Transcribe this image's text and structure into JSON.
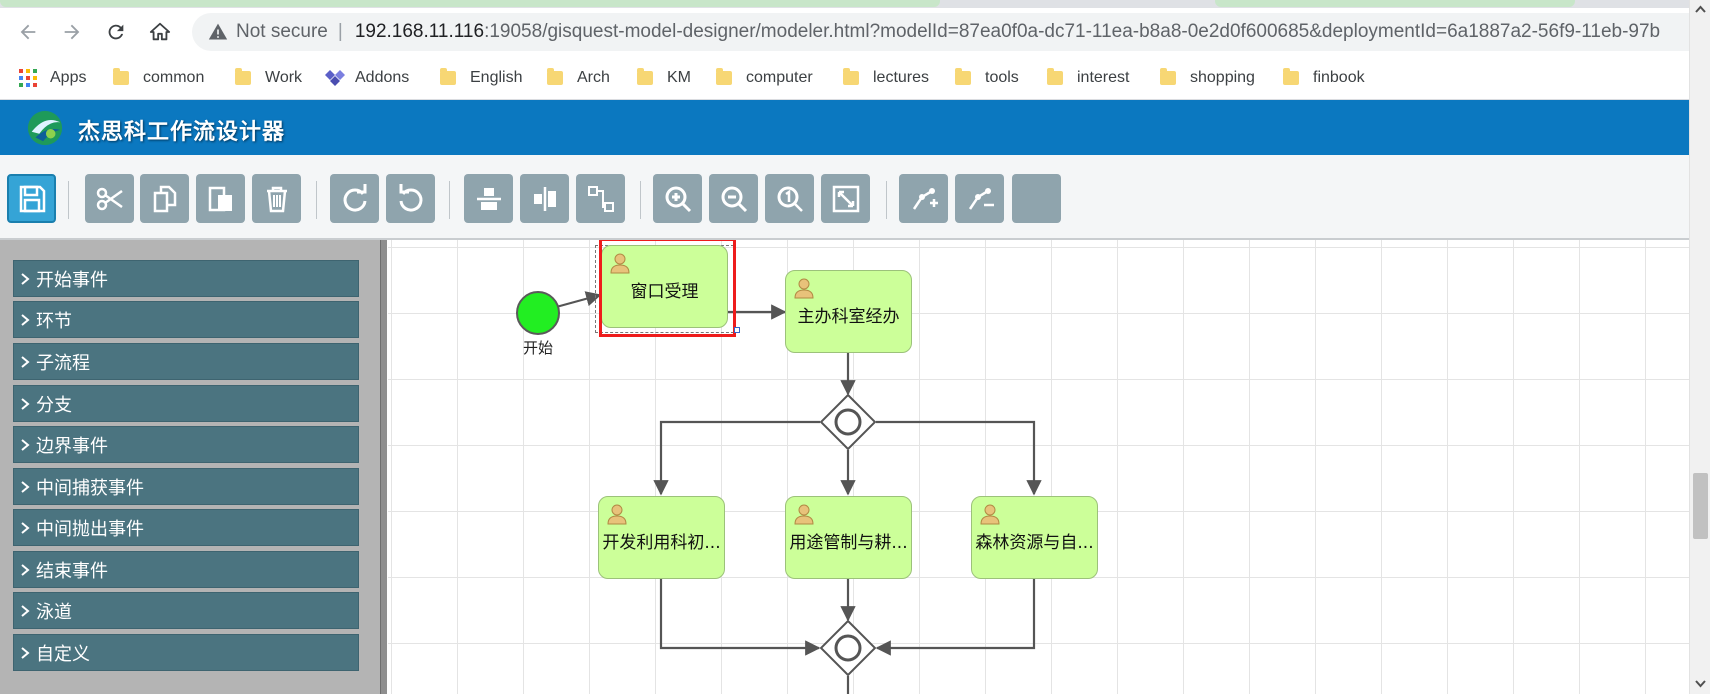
{
  "browser": {
    "url_not_secure": "Not secure",
    "url_host": "192.168.11.116",
    "url_rest": ":19058/gisquest-model-designer/modeler.html?modelId=87ea0f0a-dc71-11ea-b8a8-0e2d0f600685&deploymentId=6a1887a2-56f9-11eb-97b",
    "nav_icons": [
      "back-icon",
      "forward-icon",
      "reload-icon",
      "home-icon"
    ],
    "bookmarks": [
      "Apps",
      "common",
      "Work",
      "Addons",
      "English",
      "Arch",
      "KM",
      "computer",
      "lectures",
      "tools",
      "interest",
      "shopping",
      "finbook"
    ]
  },
  "app": {
    "title": "杰思科工作流设计器",
    "header_color": "#0b78c0"
  },
  "toolbar": {
    "buttons": [
      "save-icon",
      "cut-icon",
      "copy-icon",
      "paste-icon",
      "delete-icon",
      "redo-icon",
      "undo-icon",
      "align-vertical-icon",
      "align-horizontal-icon",
      "bend-connector-icon",
      "zoom-in-icon",
      "zoom-out-icon",
      "zoom-actual-icon",
      "zoom-fit-icon",
      "add-waypoint-icon",
      "remove-waypoint-icon",
      "blank-button"
    ]
  },
  "palette": {
    "items": [
      "开始事件",
      "环节",
      "子流程",
      "分支",
      "边界事件",
      "中间捕获事件",
      "中间抛出事件",
      "结束事件",
      "泳道",
      "自定义"
    ]
  },
  "diagram": {
    "start_label": "开始",
    "tasks": [
      "窗口受理",
      "主办科室经办",
      "开发利用科初...",
      "用途管制与耕...",
      "森林资源与自..."
    ],
    "selected_task": "窗口受理",
    "task_fill": "#ccff99",
    "start_fill": "#22ee22",
    "selection_color": "#ee1c1c"
  }
}
